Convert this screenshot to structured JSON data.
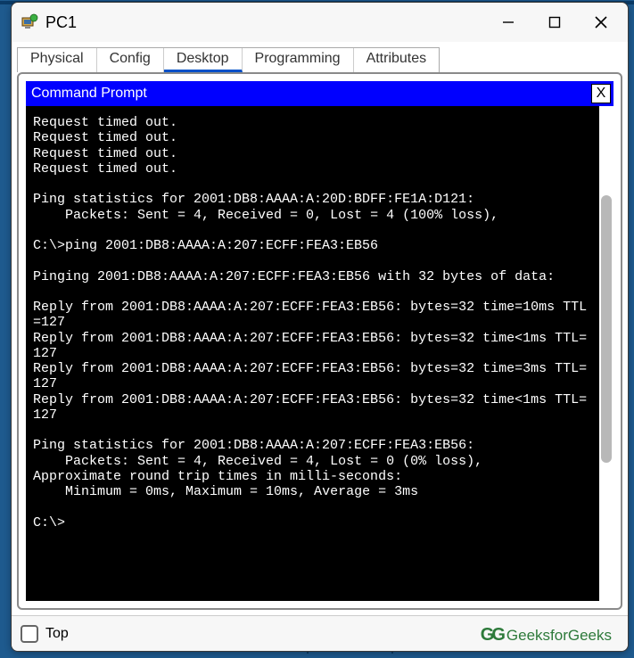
{
  "window": {
    "title": "PC1",
    "controls": {
      "minimize": "—",
      "maximize": "□",
      "close": "✕"
    }
  },
  "tabs": [
    {
      "label": "Physical",
      "active": false
    },
    {
      "label": "Config",
      "active": false
    },
    {
      "label": "Desktop",
      "active": true
    },
    {
      "label": "Programming",
      "active": false
    },
    {
      "label": "Attributes",
      "active": false
    }
  ],
  "command_prompt": {
    "title": "Command Prompt",
    "close_label": "X",
    "output": "Request timed out.\nRequest timed out.\nRequest timed out.\nRequest timed out.\n\nPing statistics for 2001:DB8:AAAA:A:20D:BDFF:FE1A:D121:\n    Packets: Sent = 4, Received = 0, Lost = 4 (100% loss),\n\nC:\\>ping 2001:DB8:AAAA:A:207:ECFF:FEA3:EB56\n\nPinging 2001:DB8:AAAA:A:207:ECFF:FEA3:EB56 with 32 bytes of data:\n\nReply from 2001:DB8:AAAA:A:207:ECFF:FEA3:EB56: bytes=32 time=10ms TTL=127\nReply from 2001:DB8:AAAA:A:207:ECFF:FEA3:EB56: bytes=32 time<1ms TTL=127\nReply from 2001:DB8:AAAA:A:207:ECFF:FEA3:EB56: bytes=32 time=3ms TTL=127\nReply from 2001:DB8:AAAA:A:207:ECFF:FEA3:EB56: bytes=32 time<1ms TTL=127\n\nPing statistics for 2001:DB8:AAAA:A:207:ECFF:FEA3:EB56:\n    Packets: Sent = 4, Received = 4, Lost = 0 (0% loss),\nApproximate round trip times in milli-seconds:\n    Minimum = 0ms, Maximum = 10ms, Average = 3ms\n\nC:\\>"
  },
  "bottom": {
    "top_label": "Top"
  },
  "watermark": {
    "logo": "GG",
    "text": "GeeksforGeeks"
  }
}
